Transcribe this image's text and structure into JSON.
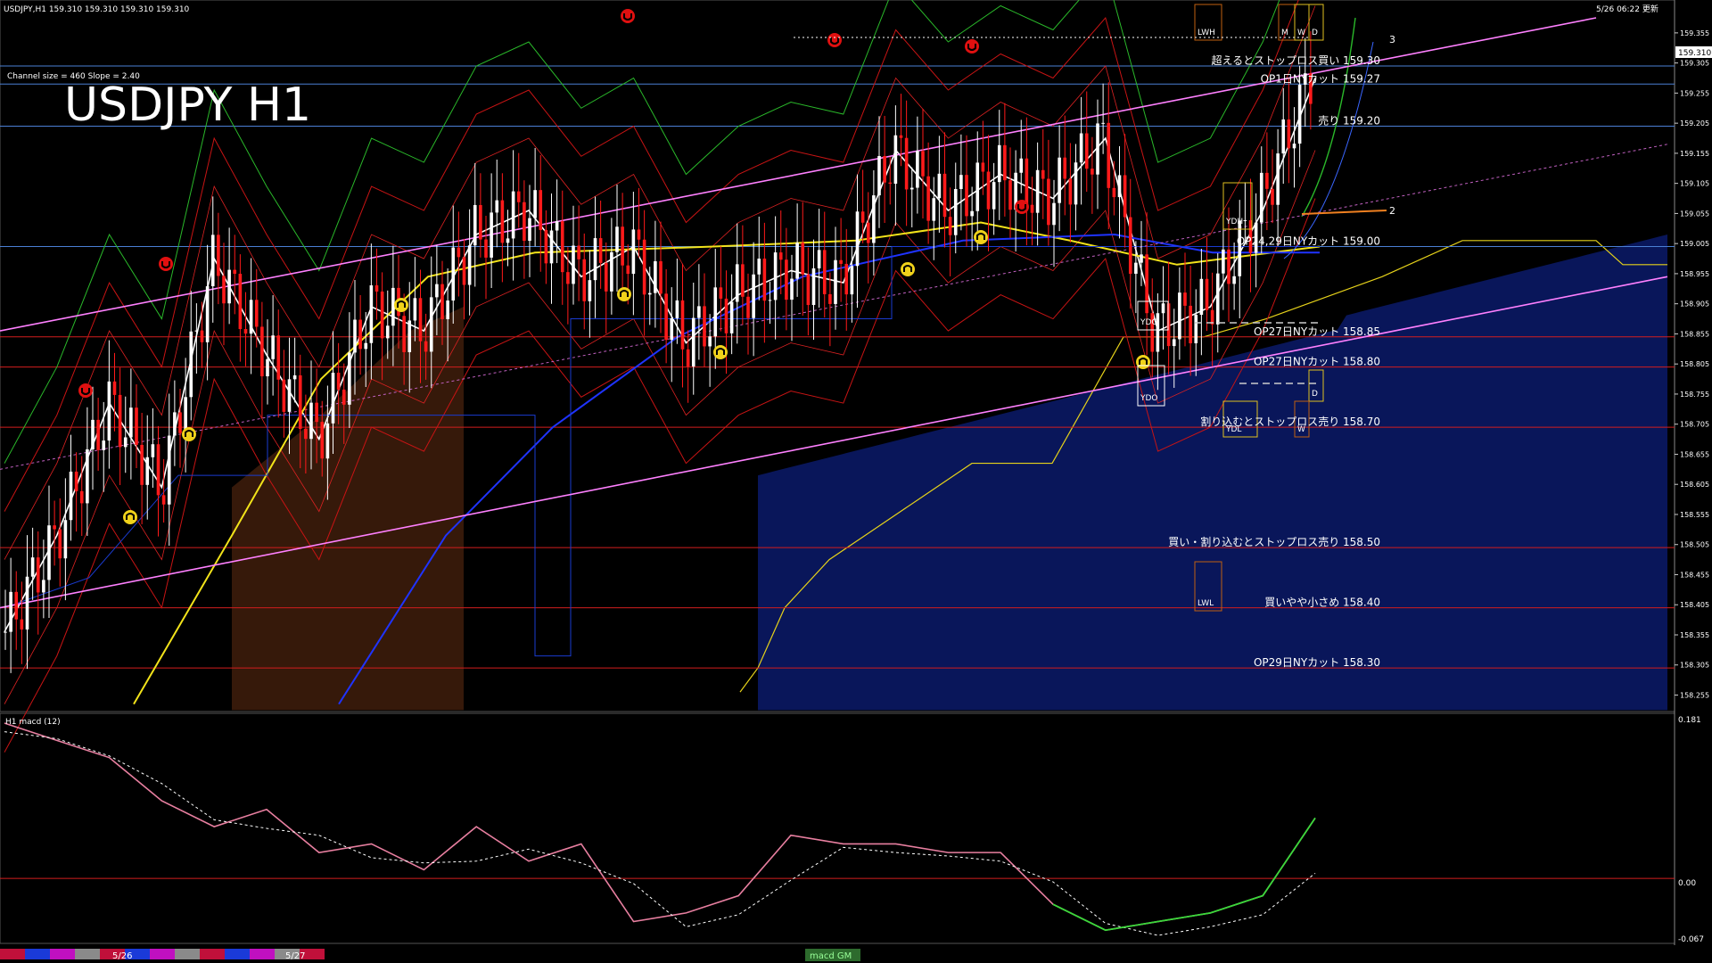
{
  "header": {
    "symbol_info": "USDJPY,H1  159.310 159.310 159.310 159.310",
    "timestamp": "5/26 06:22 更新",
    "channel_info": "Channel size = 460 Slope = 2.40",
    "big_title": "USDJPY H1",
    "current_price": "159.310"
  },
  "price_axis": {
    "ticks": [
      "159.355",
      "159.305",
      "159.255",
      "159.205",
      "159.155",
      "159.105",
      "159.055",
      "159.005",
      "158.955",
      "158.905",
      "158.855",
      "158.805",
      "158.755",
      "158.705",
      "158.655",
      "158.605",
      "158.555",
      "158.505",
      "158.455",
      "158.405",
      "158.355",
      "158.305",
      "158.255"
    ]
  },
  "level_labels": [
    {
      "text": "超えるとストップロス買い 159.30",
      "price": 159.3,
      "color": "#4a7fd4"
    },
    {
      "text": "OP1日NYカット 159.27",
      "price": 159.27,
      "color": "#4a7fd4"
    },
    {
      "text": "売り 159.20",
      "price": 159.2,
      "color": "#4a7fd4"
    },
    {
      "text": "OP24,29日NYカット 159.00",
      "price": 159.0,
      "color": "#4a7fd4"
    },
    {
      "text": "OP27日NYカット 158.85",
      "price": 158.85,
      "color": "#d21e1e"
    },
    {
      "text": "OP27日NYカット 158.80",
      "price": 158.8,
      "color": "#d21e1e"
    },
    {
      "text": "割り込むとストップロス売り 158.70",
      "price": 158.7,
      "color": "#d21e1e"
    },
    {
      "text": "買い・割り込むとストップロス売り 158.50",
      "price": 158.5,
      "color": "#d21e1e"
    },
    {
      "text": "買いやや小さめ 158.40",
      "price": 158.4,
      "color": "#d21e1e"
    },
    {
      "text": "OP29日NYカット 158.30",
      "price": 158.3,
      "color": "#d21e1e"
    }
  ],
  "box_labels": [
    "LWH",
    "YDH",
    "YDC",
    "YDO",
    "YDL",
    "LWL",
    "M",
    "W",
    "D",
    "D",
    "W"
  ],
  "marker_numbers": [
    "3",
    "2"
  ],
  "macd": {
    "title": "H1  macd (12)",
    "ticks": [
      "0.181",
      "0.00",
      "-0.067"
    ]
  },
  "time_axis": {
    "labels": [
      "5/26",
      "5/27"
    ],
    "tab_label": "macd GM"
  },
  "chart_data": {
    "type": "line",
    "title": "USDJPY H1",
    "ylabel": "",
    "xlabel": "",
    "ylim": [
      158.23,
      159.39
    ],
    "close_series": [
      {
        "name": "",
        "x": [
          0,
          10,
          20,
          30,
          40,
          50,
          60,
          70,
          80,
          90,
          100,
          110,
          120,
          130,
          140,
          150,
          160,
          170,
          180,
          190,
          200,
          210,
          220,
          230,
          240,
          250
        ],
        "values": [
          158.36,
          158.52,
          158.74,
          158.6,
          158.98,
          158.82,
          158.68,
          158.9,
          158.86,
          159.02,
          159.06,
          158.95,
          159.0,
          158.84,
          158.92,
          158.96,
          158.94,
          159.16,
          159.06,
          159.12,
          159.08,
          159.18,
          158.86,
          158.9,
          159.06,
          159.28
        ]
      }
    ],
    "channel": {
      "slope": 2.4,
      "size": 460
    },
    "macd": {
      "ylim": [
        -0.067,
        0.181
      ],
      "values": [
        0.18,
        0.16,
        0.14,
        0.09,
        0.06,
        0.08,
        0.03,
        0.04,
        0.01,
        0.06,
        0.02,
        0.04,
        -0.05,
        -0.04,
        -0.02,
        0.05,
        0.04,
        0.04,
        0.03,
        0.03,
        -0.03,
        -0.06,
        -0.05,
        -0.04,
        -0.02,
        0.07
      ]
    },
    "grid": false,
    "legend": "none"
  }
}
